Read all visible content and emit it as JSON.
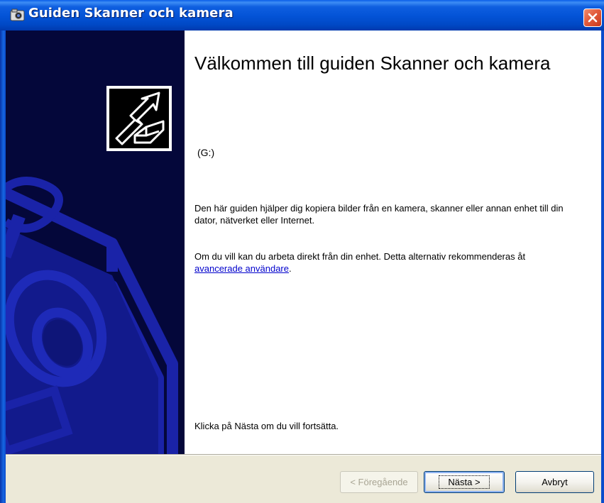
{
  "window": {
    "title": "Guiden Skanner och kamera"
  },
  "content": {
    "heading": "Välkommen till guiden Skanner och kamera",
    "device": "(G:)",
    "paragraph1": "Den här guiden hjälper dig kopiera bilder från en kamera, skanner eller annan enhet till din dator, nätverket eller Internet.",
    "paragraph2_prefix": "Om du vill kan du arbeta direkt från din enhet. Detta alternativ rekommenderas åt ",
    "paragraph2_link": "avancerade användare",
    "paragraph2_suffix": ".",
    "continue_text": "Klicka på Nästa om du vill fortsätta."
  },
  "buttons": {
    "back": "< Föregående",
    "next": "Nästa >",
    "cancel": "Avbryt",
    "back_enabled": false
  },
  "icons": {
    "title": "camera-icon",
    "close": "close-icon",
    "banner": "camera-banner-icon",
    "wizard": "wizard-arrow-icon"
  },
  "colors": {
    "titlebar": "#0454d8",
    "banner": "#04073a",
    "banner_art": "#1a23a8",
    "close": "#e25b3c",
    "link": "#0000cc",
    "face": "#ece9d8"
  }
}
